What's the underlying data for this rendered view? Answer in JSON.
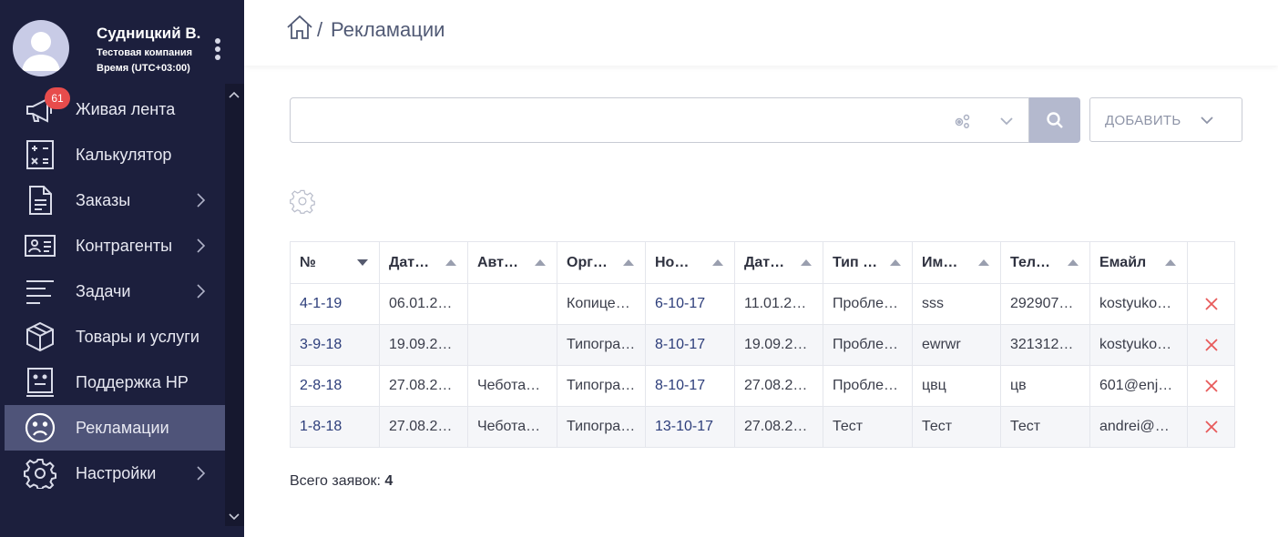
{
  "user": {
    "name": "Судницкий В.",
    "company": "Тестовая компания",
    "timezone": "Время (UTC+03:00)"
  },
  "menu": [
    {
      "label": "Живая лента",
      "icon": "megaphone-icon",
      "badge": "61",
      "has_chevron": false,
      "active": false
    },
    {
      "label": "Калькулятор",
      "icon": "calculator-icon",
      "has_chevron": false,
      "active": false
    },
    {
      "label": "Заказы",
      "icon": "document-icon",
      "has_chevron": true,
      "active": false
    },
    {
      "label": "Контрагенты",
      "icon": "contact-card-icon",
      "has_chevron": true,
      "active": false
    },
    {
      "label": "Задачи",
      "icon": "task-lines-icon",
      "has_chevron": true,
      "active": false
    },
    {
      "label": "Товары и услуги",
      "icon": "box-icon",
      "has_chevron": false,
      "active": false
    },
    {
      "label": "Поддержка HP",
      "icon": "support-face-icon",
      "has_chevron": false,
      "active": false
    },
    {
      "label": "Рекламации",
      "icon": "sad-face-icon",
      "has_chevron": false,
      "active": true
    },
    {
      "label": "Настройки",
      "icon": "gear-icon",
      "has_chevron": true,
      "active": false
    }
  ],
  "breadcrumb": {
    "separator": "/",
    "title": "Рекламации"
  },
  "search": {
    "value": "",
    "placeholder": ""
  },
  "add_button": {
    "label": "ДОБАВИТЬ"
  },
  "table": {
    "columns": [
      "№",
      "Дат…",
      "Авт…",
      "Орг…",
      "Но…",
      "Дат…",
      "Тип …",
      "Им…",
      "Тел…",
      "Емайл",
      ""
    ],
    "rows": [
      [
        "4-1-19",
        "06.01.20…",
        "",
        "Копице…",
        "6-10-17",
        "11.01.20…",
        "Пробле…",
        "sss",
        "2929072…",
        "kostyukov…"
      ],
      [
        "3-9-18",
        "19.09.20…",
        "",
        "Типогра…",
        "8-10-17",
        "19.09.20…",
        "Пробле…",
        "ewrwr",
        "3213123…",
        "kostyukov…"
      ],
      [
        "2-8-18",
        "27.08.20…",
        "Чеботар…",
        "Типогра…",
        "8-10-17",
        "27.08.20…",
        "Пробле…",
        "цвц",
        "цв",
        "601@enjo…"
      ],
      [
        "1-8-18",
        "27.08.20…",
        "Чеботар…",
        "Типогра…",
        "13-10-17",
        "27.08.20…",
        "Тест",
        "Тест",
        "Тест",
        "andrei@m…"
      ]
    ]
  },
  "total": {
    "label": "Всего заявок:",
    "count": "4"
  },
  "colors": {
    "sidebar_bg": "#1c1f3d",
    "active_item_bg": "#4f5479",
    "badge": "#e74c4c",
    "link": "#2c3d7a",
    "delete": "#e85a5a",
    "search_button": "#b4b9ce"
  }
}
